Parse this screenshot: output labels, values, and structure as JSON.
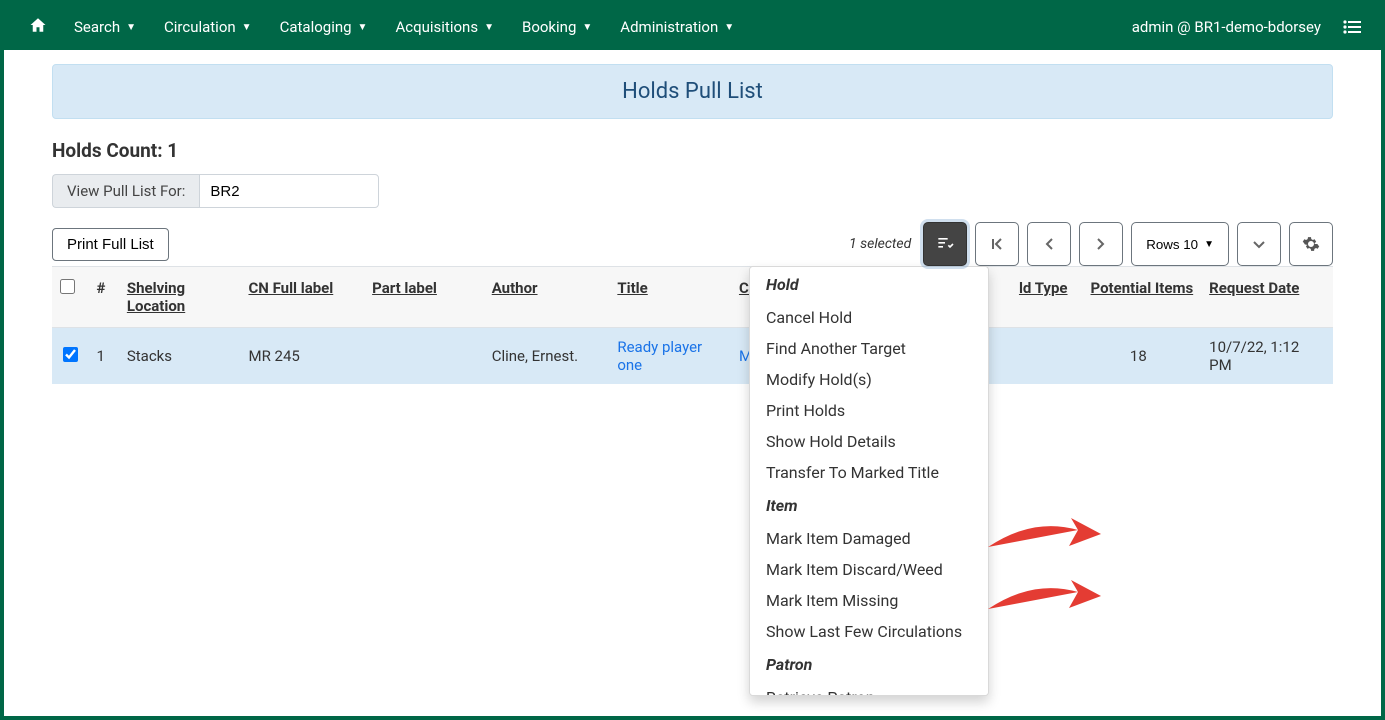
{
  "topnav": {
    "items": [
      {
        "label": "Search"
      },
      {
        "label": "Circulation"
      },
      {
        "label": "Cataloging"
      },
      {
        "label": "Acquisitions"
      },
      {
        "label": "Booking"
      },
      {
        "label": "Administration"
      }
    ],
    "user": "admin @ BR1-demo-bdorsey"
  },
  "banner": {
    "title": "Holds Pull List"
  },
  "holds_count": {
    "label": "Holds Count: 1"
  },
  "pull_list": {
    "label": "View Pull List For:",
    "value": "BR2"
  },
  "print_button": "Print Full List",
  "toolbar": {
    "selected_text": "1 selected",
    "rows_label": "Rows 10"
  },
  "columns": {
    "num": "#",
    "shelving": "Shelving Location",
    "cn": "CN Full label",
    "part": "Part label",
    "author": "Author",
    "title": "Title",
    "current_prefix": "Cu",
    "holdtype_suffix": "ld Type",
    "potential": "Potential Items",
    "request": "Request Date"
  },
  "rows": [
    {
      "checked": true,
      "num": "1",
      "shelving": "Stacks",
      "cn": "MR 245",
      "part": "",
      "author": "Cline, Ernest.",
      "title": "Ready player one",
      "current_visible": "M",
      "holdtype": "",
      "potential": "18",
      "request": "10/7/22, 1:12 PM"
    }
  ],
  "dropdown": {
    "sections": [
      {
        "header": "Hold",
        "items": [
          "Cancel Hold",
          "Find Another Target",
          "Modify Hold(s)",
          "Print Holds",
          "Show Hold Details",
          "Transfer To Marked Title"
        ]
      },
      {
        "header": "Item",
        "items": [
          "Mark Item Damaged",
          "Mark Item Discard/Weed",
          "Mark Item Missing",
          "Show Last Few Circulations"
        ]
      },
      {
        "header": "Patron",
        "items": [
          "Retrieve Patron"
        ]
      }
    ]
  }
}
